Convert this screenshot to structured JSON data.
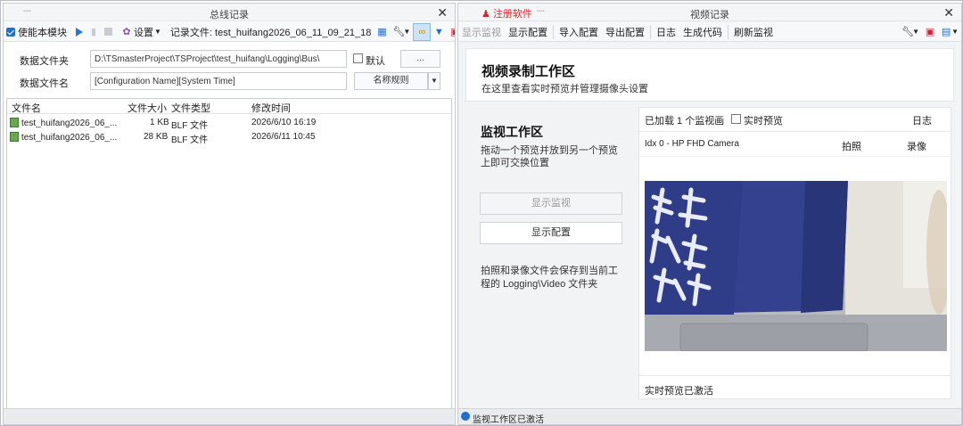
{
  "left": {
    "title": "总线记录",
    "toolbar": {
      "enable_label": "使能本模块",
      "settings_label": "设置",
      "record_file_label": "记录文件: test_huifang2026_06_11_09_21_18"
    },
    "form": {
      "folder_label": "数据文件夹",
      "folder_value": "D:\\TSmasterProject\\TSProject\\test_huifang\\Logging\\Bus\\",
      "default_label": "默认",
      "browse_label": "...",
      "filename_label": "数据文件名",
      "filename_value": "[Configuration Name][System Time]",
      "naming_rule_label": "名称规则"
    },
    "table": {
      "columns": [
        "文件名",
        "文件大小",
        "文件类型",
        "修改时间"
      ],
      "rows": [
        {
          "name": "test_huifang2026_06_...",
          "size": "1 KB",
          "type": "BLF 文件",
          "modified": "2026/6/10 16:19"
        },
        {
          "name": "test_huifang2026_06_...",
          "size": "28 KB",
          "type": "BLF 文件",
          "modified": "2026/6/11 10:45"
        }
      ]
    }
  },
  "right": {
    "register_label": "注册软件",
    "title": "视频记录",
    "toolbar": [
      "显示监视",
      "显示配置",
      "导入配置",
      "导出配置",
      "日志",
      "生成代码",
      "刷新监视"
    ],
    "header": {
      "title": "视频录制工作区",
      "subtitle": "在这里查看实时预览并管理摄像头设置"
    },
    "workspace": {
      "title": "监视工作区",
      "desc": "拖动一个预览并放到另一个预览上即可交换位置",
      "show_monitor_label": "显示监视",
      "show_config_label": "显示配置",
      "note": "拍照和录像文件会保存到当前工程的 Logging\\Video 文件夹"
    },
    "monitor": {
      "loaded_text": "已加载 1 个监视画",
      "live_preview_label": "实时预览",
      "log_label": "日志",
      "camera_name": "Idx 0 - HP FHD Camera",
      "snapshot_label": "拍照",
      "record_label": "录像",
      "status_text": "实时预览已激活"
    },
    "status_text": "监视工作区已激活",
    "accent_color": "#d9262c"
  }
}
